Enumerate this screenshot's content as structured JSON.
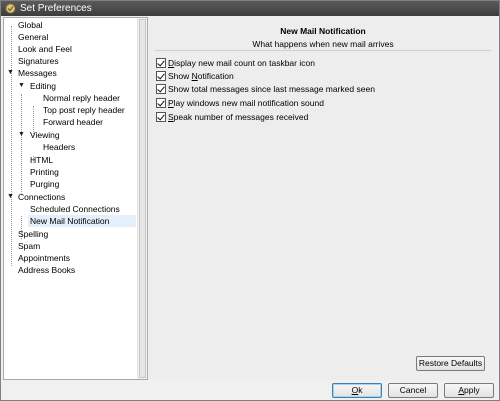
{
  "window": {
    "title": "Set Preferences"
  },
  "tree": {
    "items": [
      {
        "label": "Global"
      },
      {
        "label": "General"
      },
      {
        "label": "Look and Feel"
      },
      {
        "label": "Signatures"
      },
      {
        "label": "Messages"
      },
      {
        "label": "Editing"
      },
      {
        "label": "Normal reply header"
      },
      {
        "label": "Top post reply header"
      },
      {
        "label": "Forward header"
      },
      {
        "label": "Viewing"
      },
      {
        "label": "Headers"
      },
      {
        "label": "HTML"
      },
      {
        "label": "Printing"
      },
      {
        "label": "Purging"
      },
      {
        "label": "Connections"
      },
      {
        "label": "Scheduled Connections"
      },
      {
        "label": "New Mail Notification"
      },
      {
        "label": "Spelling"
      },
      {
        "label": "Spam"
      },
      {
        "label": "Appointments"
      },
      {
        "label": "Address Books"
      }
    ]
  },
  "panel": {
    "title": "New Mail Notification",
    "subtitle": "What happens when new mail arrives",
    "options": [
      {
        "pre": "",
        "key": "D",
        "post": "isplay new mail count on taskbar icon",
        "checked": true
      },
      {
        "pre": "Show ",
        "key": "N",
        "post": "otification",
        "checked": true
      },
      {
        "pre": "Show total messages since last message marked seen",
        "key": "",
        "post": "",
        "checked": true
      },
      {
        "pre": "",
        "key": "P",
        "post": "lay windows new mail notification sound",
        "checked": true
      },
      {
        "pre": "",
        "key": "S",
        "post": "peak number of messages received",
        "checked": true
      }
    ],
    "restore_label": "Restore Defaults"
  },
  "buttons": {
    "ok": {
      "pre": "",
      "key": "O",
      "post": "k"
    },
    "cancel": {
      "pre": "",
      "key": "",
      "post": "Cancel"
    },
    "apply": {
      "pre": "",
      "key": "A",
      "post": "pply"
    }
  },
  "colors": {
    "titlebar": "#4a4a4a",
    "selection": "#e5eefb",
    "default_button_border": "#3c7fb1"
  }
}
